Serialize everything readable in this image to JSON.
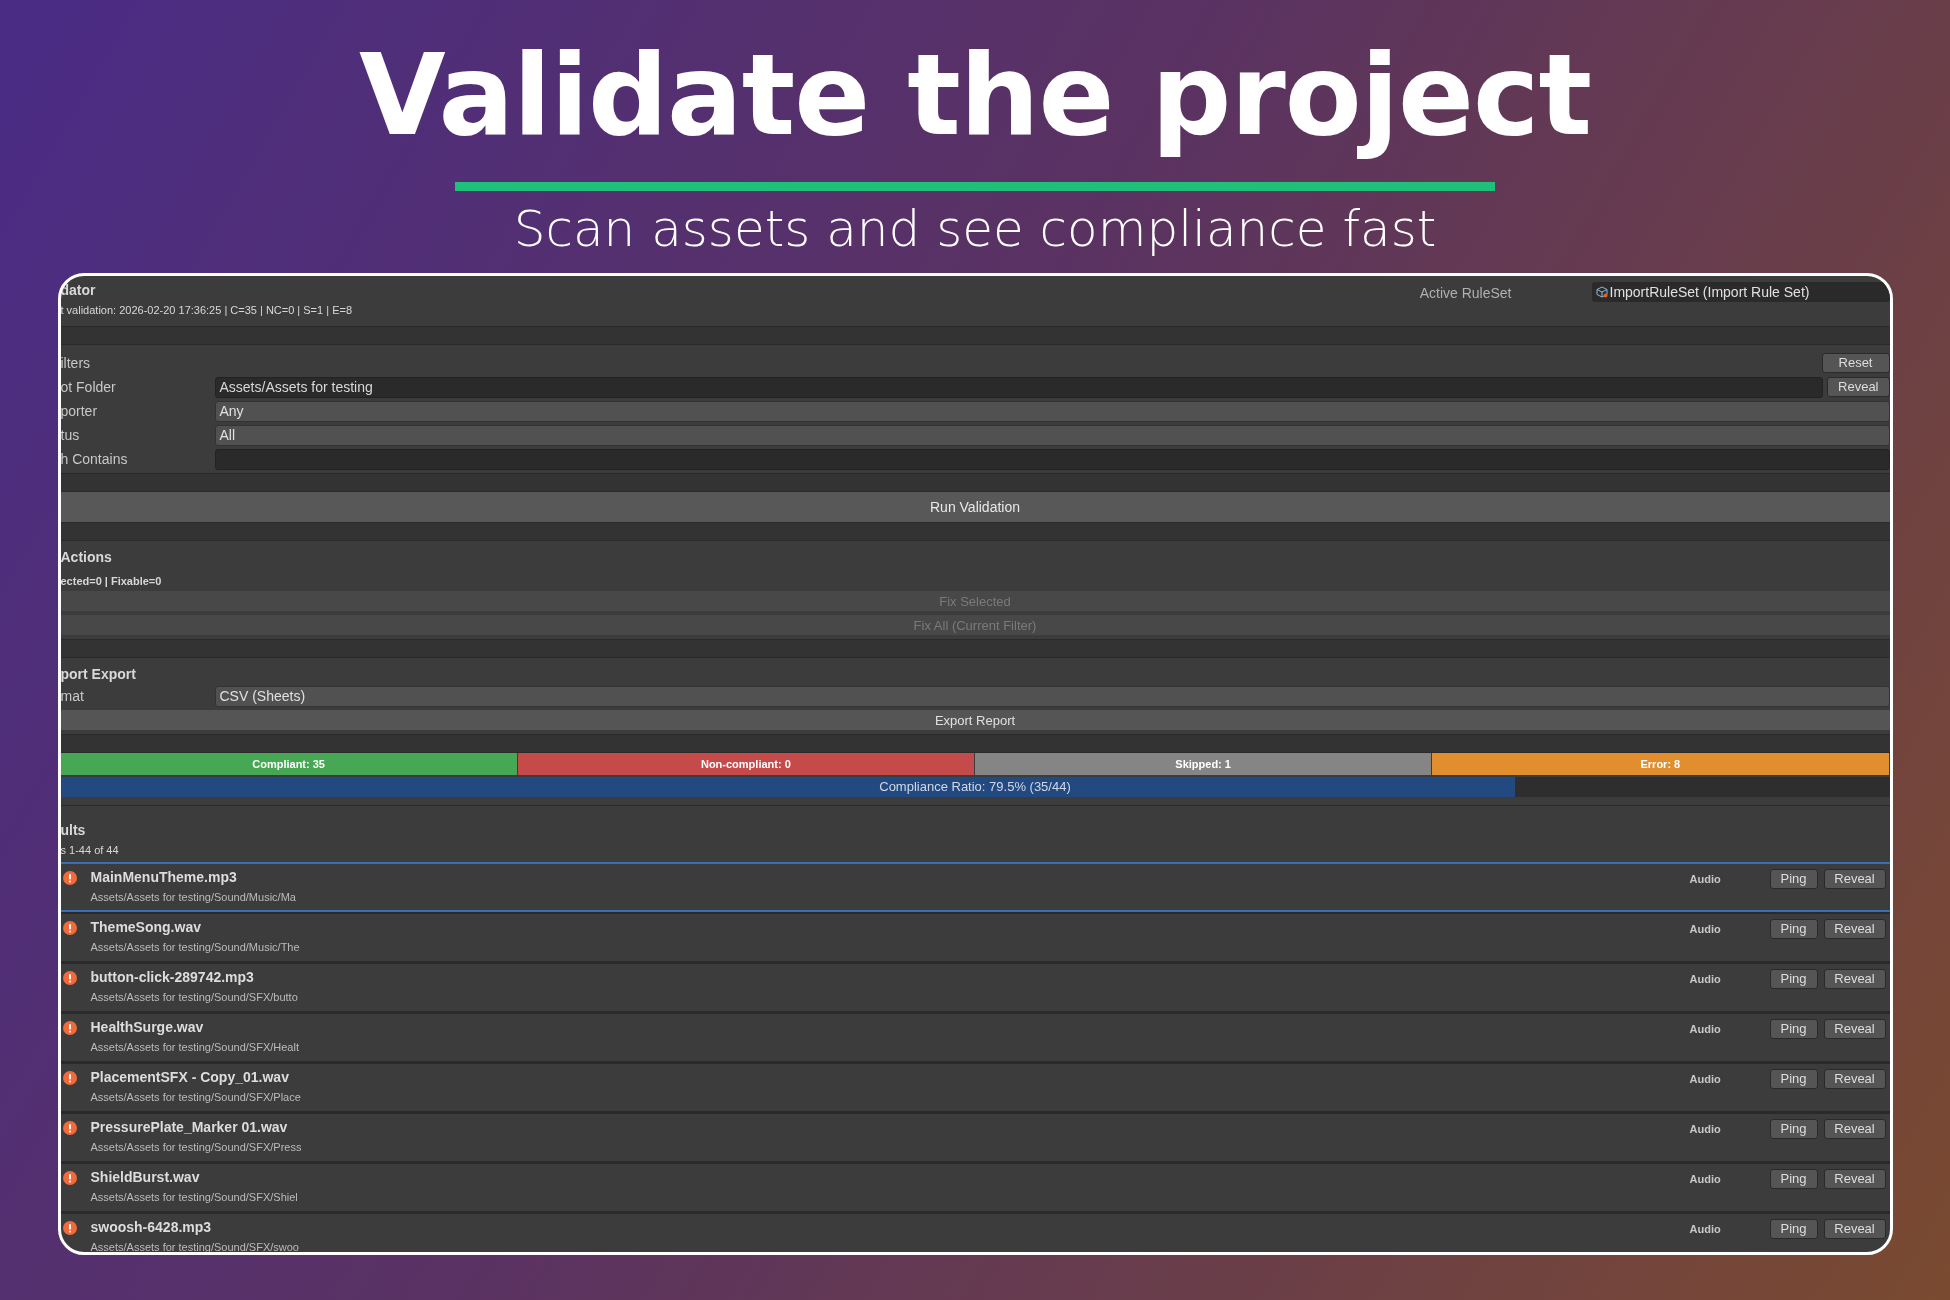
{
  "headline": "Validate the project",
  "subtitle": "Scan assets and see compliance fast",
  "window": {
    "title": "dator",
    "last_validation": "t validation: 2026-02-20 17:36:25 | C=35 | NC=0 | S=1 | E=8",
    "ruleset_label": "Active RuleSet",
    "ruleset_value": "ImportRuleSet (Import Rule Set)"
  },
  "filters": {
    "title": "ilters",
    "reset_button": "Reset",
    "reveal_button": "Reveal",
    "fields": [
      {
        "label": "ot Folder",
        "value": "Assets/Assets for testing",
        "kind": "text"
      },
      {
        "label": "porter",
        "value": "Any",
        "kind": "dropdown"
      },
      {
        "label": "tus",
        "value": "All",
        "kind": "dropdown"
      },
      {
        "label": "h Contains",
        "kind": "text"
      }
    ]
  },
  "run_button": "Run Validation",
  "actions": {
    "title": "Actions",
    "summary": "ected=0 | Fixable=0",
    "buttons": [
      {
        "label": "Fix Selected",
        "disabled": true
      },
      {
        "label": "Fix All (Current Filter)",
        "disabled": true
      }
    ]
  },
  "report_export": {
    "title": "port Export",
    "format_label": "mat",
    "format_value": "CSV (Sheets)",
    "export_button": "Export Report"
  },
  "summary_bar": [
    {
      "label": "Compliant: 35",
      "color": "#46a854"
    },
    {
      "label": "Non-compliant: 0",
      "color": "#c54b4b"
    },
    {
      "label": "Skipped: 1",
      "color": "#858585"
    },
    {
      "label": "Error: 8",
      "color": "#e08e2e"
    }
  ],
  "compliance": {
    "label": "Compliance Ratio: 79.5% (35/44)",
    "level": 0.795
  },
  "results": {
    "title": "ults",
    "count": "s 1-44 of 44",
    "rows": [
      {
        "name": "MainMenuTheme.mp3",
        "path": "Assets/Assets for testing/Sound/Music/Ma",
        "type": "Audio",
        "kind": "error",
        "selected": true,
        "ping": "Ping",
        "reveal": "Reveal"
      },
      {
        "name": "ThemeSong.wav",
        "path": "Assets/Assets for testing/Sound/Music/The",
        "type": "Audio",
        "kind": "error",
        "selected": false,
        "ping": "Ping",
        "reveal": "Reveal"
      },
      {
        "name": "button-click-289742.mp3",
        "path": "Assets/Assets for testing/Sound/SFX/butto",
        "type": "Audio",
        "kind": "error",
        "selected": false,
        "ping": "Ping",
        "reveal": "Reveal"
      },
      {
        "name": "HealthSurge.wav",
        "path": "Assets/Assets for testing/Sound/SFX/Healt",
        "type": "Audio",
        "kind": "error",
        "selected": false,
        "ping": "Ping",
        "reveal": "Reveal"
      },
      {
        "name": "PlacementSFX - Copy_01.wav",
        "path": "Assets/Assets for testing/Sound/SFX/Place",
        "type": "Audio",
        "kind": "error",
        "selected": false,
        "ping": "Ping",
        "reveal": "Reveal"
      },
      {
        "name": "PressurePlate_Marker 01.wav",
        "path": "Assets/Assets for testing/Sound/SFX/Press",
        "type": "Audio",
        "kind": "error",
        "selected": false,
        "ping": "Ping",
        "reveal": "Reveal"
      },
      {
        "name": "ShieldBurst.wav",
        "path": "Assets/Assets for testing/Sound/SFX/Shiel",
        "type": "Audio",
        "kind": "error",
        "selected": false,
        "ping": "Ping",
        "reveal": "Reveal"
      },
      {
        "name": "swoosh-6428.mp3",
        "path": "Assets/Assets for testing/Sound/SFX/swoo",
        "type": "Audio",
        "kind": "error",
        "selected": false,
        "ping": "Ping",
        "reveal": "Reveal"
      }
    ]
  }
}
